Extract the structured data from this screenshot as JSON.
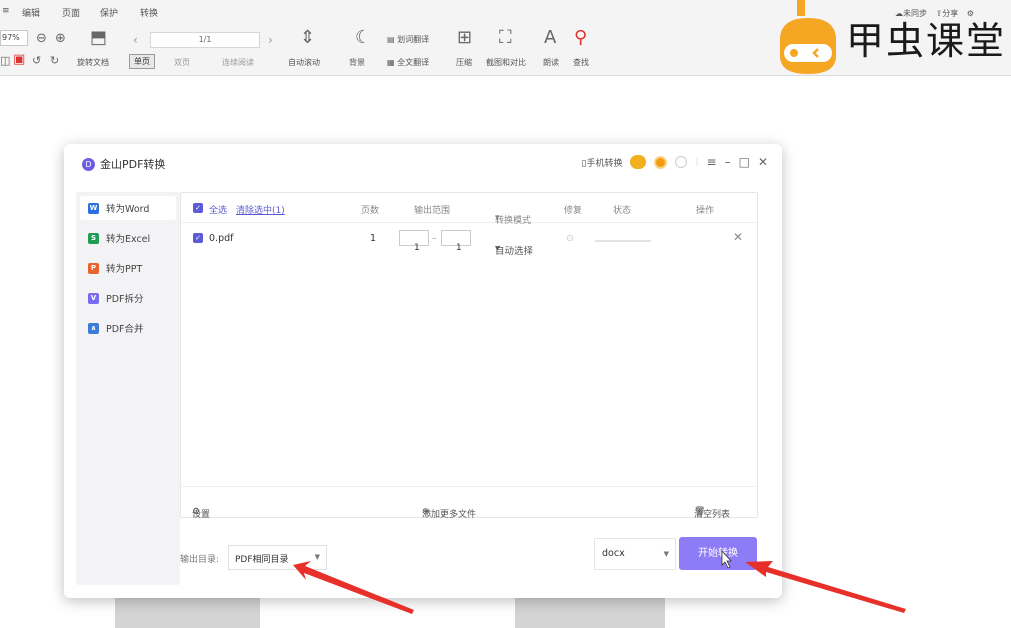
{
  "toolbar": {
    "menus": [
      "编辑",
      "页面",
      "保护",
      "转换"
    ],
    "zoom": "97%",
    "page_indicator": "1/1",
    "items": [
      "旋转文档",
      "单页",
      "双页",
      "连续阅读",
      "自动滚动",
      "背景",
      "全文翻译",
      "压缩",
      "截图和对比",
      "朗读",
      "查找"
    ],
    "word_translate": "划词翻译",
    "sync_status": "未同步",
    "share": "分享"
  },
  "logo": {
    "text": "甲虫课堂"
  },
  "dialog": {
    "title": "金山PDF转换",
    "mobile_convert": "手机转换",
    "sidebar": [
      {
        "label": "转为Word",
        "icon": "word-icon",
        "color": "#2b6fe0"
      },
      {
        "label": "转为Excel",
        "icon": "excel-icon",
        "color": "#1f9d55"
      },
      {
        "label": "转为PPT",
        "icon": "ppt-icon",
        "color": "#e8642c"
      },
      {
        "label": "PDF拆分",
        "icon": "split-icon",
        "color": "#7a6cf0"
      },
      {
        "label": "PDF合并",
        "icon": "merge-icon",
        "color": "#3d7bd9"
      }
    ],
    "table": {
      "headers": {
        "select_all": "全选",
        "clear_selected": "清除选中(1)",
        "pages": "页数",
        "output_range": "输出范围",
        "mode": "转换模式",
        "repair": "修复",
        "status": "状态",
        "action": "操作"
      },
      "rows": [
        {
          "file": "0.pdf",
          "pages": "1",
          "range_from": "1",
          "range_to": "1",
          "mode": "自动选择"
        }
      ]
    },
    "footer": {
      "settings": "设置",
      "add_more": "添加更多文件",
      "clear_list": "清空列表"
    },
    "output_dir_label": "输出目录:",
    "output_dir_value": "PDF相同目录",
    "format": "docx",
    "start_button": "开始转换"
  },
  "colors": {
    "accent": "#8e7cf6",
    "arrow": "#e8302a"
  }
}
